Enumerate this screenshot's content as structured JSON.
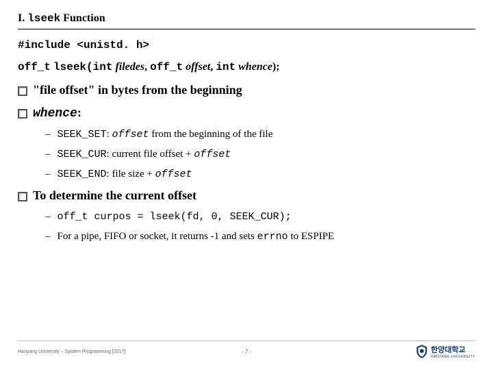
{
  "title": {
    "prefix": "I.",
    "func": "lseek",
    "suffix": "Function"
  },
  "include_line": "#include <unistd. h>",
  "proto": {
    "ret": "off_t",
    "name": "lseek(int",
    "arg1": "filedes",
    "sep1": ",",
    "type2": "off_t",
    "arg2": "offset",
    "sep2": ",",
    "type3": "int",
    "arg3": "whence",
    "end": ");"
  },
  "bullet1": "\"file offset\" in bytes from the beginning",
  "bullet2_mono": "whence",
  "bullet2_suffix": ":",
  "sub_a": {
    "label": "SEEK_SET",
    "colon": ":",
    "offset": "offset",
    "rest": " from the beginning of the file"
  },
  "sub_b": {
    "label": "SEEK_CUR",
    "colon": ":",
    "prefix": " current file offset + ",
    "offset": "offset"
  },
  "sub_c": {
    "label": "SEEK_END",
    "colon": ":",
    "prefix": " file size + ",
    "offset": "offset"
  },
  "bullet3": "To determine the current offset",
  "sub_d": {
    "code": "off_t curpos = lseek(fd, 0, SEEK_CUR);"
  },
  "sub_e": {
    "prefix": "For a pipe, FIFO or socket, it returns -1 and sets ",
    "errno": "errno",
    "mid": " to ",
    "espipe": "ESPIPE"
  },
  "footer": {
    "left": "Hanyang University – System Programming [2017]",
    "page": "- 7 -",
    "uni_kr": "한양대학교",
    "uni_en": "HANYANG UNIVERSITY"
  }
}
